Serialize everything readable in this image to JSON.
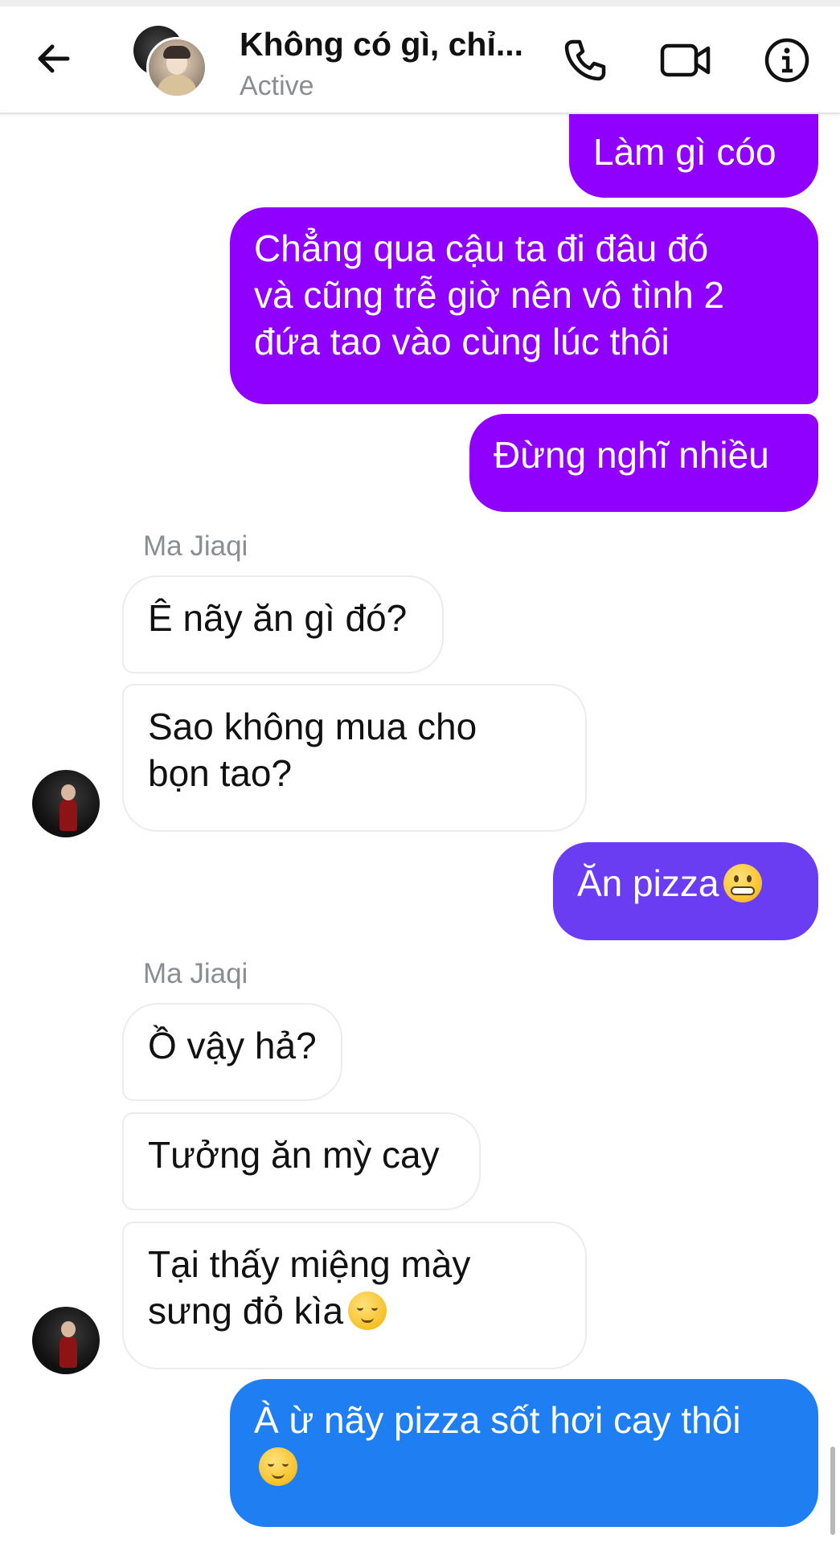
{
  "header": {
    "contact_name": "Không có gì, chỉ...",
    "status": "Active",
    "icons": {
      "back": "back-arrow-icon",
      "call": "phone-icon",
      "video": "video-camera-icon",
      "info": "info-icon"
    }
  },
  "colors": {
    "outgoing_purple": "#8f00ff",
    "outgoing_indigo": "#6a3cf2",
    "outgoing_blue": "#1f7ff2",
    "incoming_bg": "#ffffff",
    "status_gray": "#8a8d91"
  },
  "messages": [
    {
      "direction": "out",
      "text": "Làm gì cóo"
    },
    {
      "direction": "out",
      "text": "Chẳng qua cậu ta đi đâu đó\nvà cũng trễ giờ nên vô tình 2\nđứa tao vào cùng lúc thôi"
    },
    {
      "direction": "out",
      "text": "Đừng nghĩ nhiều"
    },
    {
      "direction": "sender",
      "text": "Ma Jiaqi"
    },
    {
      "direction": "in",
      "text": "Ê nãy ăn gì đó?"
    },
    {
      "direction": "in",
      "text": "Sao không mua cho\nbọn tao?"
    },
    {
      "direction": "out",
      "text": "Ăn pizza",
      "emoji": "grimacing-face-emoji"
    },
    {
      "direction": "sender",
      "text": "Ma Jiaqi"
    },
    {
      "direction": "in",
      "text": "Ồ vậy hả?"
    },
    {
      "direction": "in",
      "text": "Tưởng ăn mỳ cay"
    },
    {
      "direction": "in",
      "text": "Tại thấy miệng mày\nsưng đỏ kìa",
      "emoji": "relieved-face-emoji"
    },
    {
      "direction": "out",
      "text": "À ừ nãy pizza sốt hơi cay thôi\n",
      "emoji": "pensive-face-emoji"
    }
  ]
}
